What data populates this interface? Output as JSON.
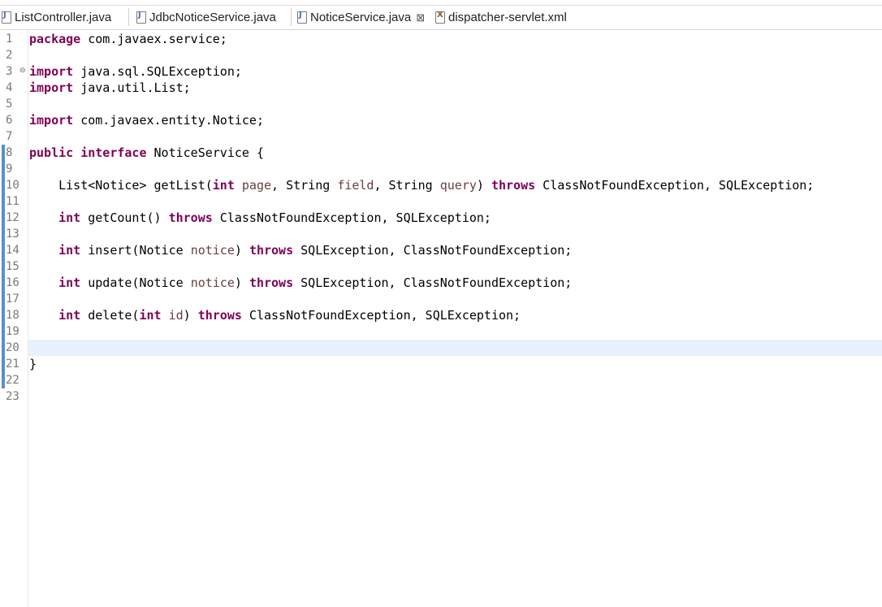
{
  "tabs": [
    {
      "label": "ListController.java"
    },
    {
      "label": "JdbcNoticeService.java"
    },
    {
      "label": "NoticeService.java",
      "close": "⊠"
    },
    {
      "label": "dispatcher-servlet.xml"
    }
  ],
  "lines": [
    {
      "n": "1"
    },
    {
      "n": "2"
    },
    {
      "n": "3"
    },
    {
      "n": "4"
    },
    {
      "n": "5"
    },
    {
      "n": "6"
    },
    {
      "n": "7"
    },
    {
      "n": "8"
    },
    {
      "n": "9"
    },
    {
      "n": "10"
    },
    {
      "n": "11"
    },
    {
      "n": "12"
    },
    {
      "n": "13"
    },
    {
      "n": "14"
    },
    {
      "n": "15"
    },
    {
      "n": "16"
    },
    {
      "n": "17"
    },
    {
      "n": "18"
    },
    {
      "n": "19"
    },
    {
      "n": "20"
    },
    {
      "n": "21"
    },
    {
      "n": "22"
    },
    {
      "n": "23"
    }
  ],
  "code": {
    "l1": {
      "kw": "package",
      "rest": " com.javaex.service;"
    },
    "l3": {
      "kw": "import",
      "rest": " java.sql.SQLException;"
    },
    "l4": {
      "kw": "import",
      "rest": " java.util.List;"
    },
    "l6": {
      "kw": "import",
      "rest": " com.javaex.entity.Notice;"
    },
    "l8": {
      "kw1": "public",
      "kw2": "interface",
      "rest": " NoticeService {"
    },
    "l10": {
      "a": "    List<Notice> getList(",
      "k1": "int",
      "p1": " page",
      "b": ", String ",
      "p2": "field",
      "c": ", String ",
      "p3": "query",
      "d": ") ",
      "k2": "throws",
      "e": " ClassNotFoundException, SQLException;"
    },
    "l12": {
      "k1": "int",
      "a": " getCount() ",
      "k2": "throws",
      "b": " ClassNotFoundException, SQLException;"
    },
    "l14": {
      "k1": "int",
      "a": " insert(Notice ",
      "p": "notice",
      "b": ") ",
      "k2": "throws",
      "c": " SQLException, ClassNotFoundException;"
    },
    "l16": {
      "k1": "int",
      "a": " update(Notice ",
      "p": "notice",
      "b": ") ",
      "k2": "throws",
      "c": " SQLException, ClassNotFoundException;"
    },
    "l18": {
      "k1": "int",
      "a": " delete(",
      "k3": "int",
      "p": " id",
      "b": ") ",
      "k2": "throws",
      "c": " ClassNotFoundException, SQLException;"
    },
    "l21": {
      "rest": "}"
    }
  },
  "colors": {
    "keyword": "#7f0055",
    "parameter": "#6a3e3e",
    "current_line": "#e8f2fe",
    "change_marker": "#5a8fc9"
  }
}
